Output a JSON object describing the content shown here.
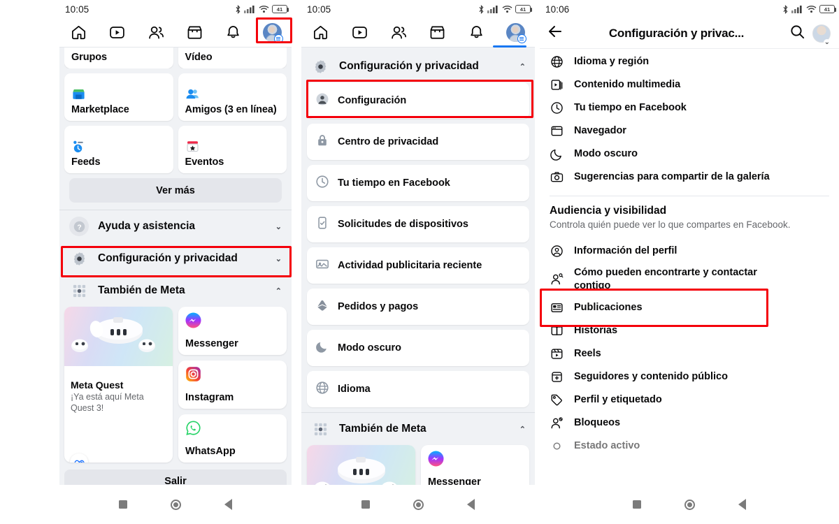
{
  "panels": [
    {
      "id": "panel-menu",
      "status": {
        "clock": "10:05",
        "battery": "41"
      },
      "tabs": [
        {
          "name": "home",
          "icon": "home-icon"
        },
        {
          "name": "video",
          "icon": "video-icon"
        },
        {
          "name": "friends",
          "icon": "friends-icon"
        },
        {
          "name": "marketplace",
          "icon": "marketplace-icon"
        },
        {
          "name": "notifications",
          "icon": "bell-icon"
        },
        {
          "name": "profile-menu",
          "icon": "avatar-menu-icon"
        }
      ],
      "shortcuts": [
        {
          "label": "Grupos",
          "icon": "groups-icon"
        },
        {
          "label": "Vídeo",
          "icon": "video-icon"
        },
        {
          "label": "Marketplace",
          "icon": "marketplace-icon"
        },
        {
          "label": "Amigos (3 en línea)",
          "icon": "friends-icon"
        },
        {
          "label": "Feeds",
          "icon": "feeds-icon"
        },
        {
          "label": "Eventos",
          "icon": "events-icon"
        }
      ],
      "see_more": "Ver más",
      "menu_rows": [
        {
          "label": "Ayuda y asistencia",
          "icon": "question-icon",
          "chevron": "⌄"
        },
        {
          "label": "Configuración y privacidad",
          "icon": "gear-icon",
          "chevron": "⌄"
        }
      ],
      "meta_section": {
        "title": "También de Meta",
        "icon": "grid-dots-icon",
        "chevron": "⌃",
        "quest": {
          "title": "Meta Quest",
          "subtitle": "¡Ya está aquí Meta Quest 3!",
          "badge": "meta-logo-icon"
        },
        "apps": [
          {
            "label": "Messenger",
            "icon": "messenger-icon"
          },
          {
            "label": "Instagram",
            "icon": "instagram-icon"
          },
          {
            "label": "WhatsApp",
            "icon": "whatsapp-icon"
          }
        ]
      },
      "logout": "Salir"
    },
    {
      "id": "panel-settings-expanded",
      "status": {
        "clock": "10:05",
        "battery": "41"
      },
      "section": {
        "title": "Configuración y privacidad",
        "icon": "gear-icon",
        "chevron": "⌃"
      },
      "items": [
        {
          "label": "Configuración",
          "icon": "person-circle-icon"
        },
        {
          "label": "Centro de privacidad",
          "icon": "lock-icon"
        },
        {
          "label": "Tu tiempo en Facebook",
          "icon": "clock-icon"
        },
        {
          "label": "Solicitudes de dispositivos",
          "icon": "device-request-icon"
        },
        {
          "label": "Actividad publicitaria reciente",
          "icon": "ad-activity-icon"
        },
        {
          "label": "Pedidos y pagos",
          "icon": "payments-icon"
        },
        {
          "label": "Modo oscuro",
          "icon": "moon-icon"
        },
        {
          "label": "Idioma",
          "icon": "globe-icon"
        }
      ],
      "meta_section": {
        "title": "También de Meta",
        "icon": "grid-dots-icon",
        "chevron": "⌃",
        "apps": [
          {
            "label": "Messenger",
            "icon": "messenger-icon"
          }
        ]
      }
    },
    {
      "id": "panel-settings-detail",
      "status": {
        "clock": "10:06",
        "battery": "41"
      },
      "header": {
        "back": "back-arrow-icon",
        "title": "Configuración y privac...",
        "search": "search-icon",
        "avatar": "avatar-icon"
      },
      "items_top": [
        {
          "label": "Idioma y región",
          "icon": "globe-icon"
        },
        {
          "label": "Contenido multimedia",
          "icon": "media-icon"
        },
        {
          "label": "Tu tiempo en Facebook",
          "icon": "clock-icon"
        },
        {
          "label": "Navegador",
          "icon": "browser-icon"
        },
        {
          "label": "Modo oscuro",
          "icon": "moon-icon"
        },
        {
          "label": "Sugerencias para compartir de la galería",
          "icon": "camera-icon"
        }
      ],
      "group": {
        "title": "Audiencia y visibilidad",
        "subtitle": "Controla quién puede ver lo que compartes en Facebook."
      },
      "items_bottom": [
        {
          "label": "Información del perfil",
          "icon": "person-circle-icon"
        },
        {
          "label": "Cómo pueden encontrarte y contactar contigo",
          "icon": "person-search-icon"
        },
        {
          "label": "Publicaciones",
          "icon": "posts-icon"
        },
        {
          "label": "Historias",
          "icon": "stories-icon"
        },
        {
          "label": "Reels",
          "icon": "reels-icon"
        },
        {
          "label": "Seguidores y contenido público",
          "icon": "followers-icon"
        },
        {
          "label": "Perfil y etiquetado",
          "icon": "tag-icon"
        },
        {
          "label": "Bloqueos",
          "icon": "block-icon"
        },
        {
          "label": "Estado activo",
          "icon": "active-status-icon"
        }
      ]
    }
  ],
  "navbar": {
    "recent": "square-icon",
    "home": "circle-icon",
    "back": "triangle-back-icon"
  },
  "highlight_color": "#f4000b"
}
